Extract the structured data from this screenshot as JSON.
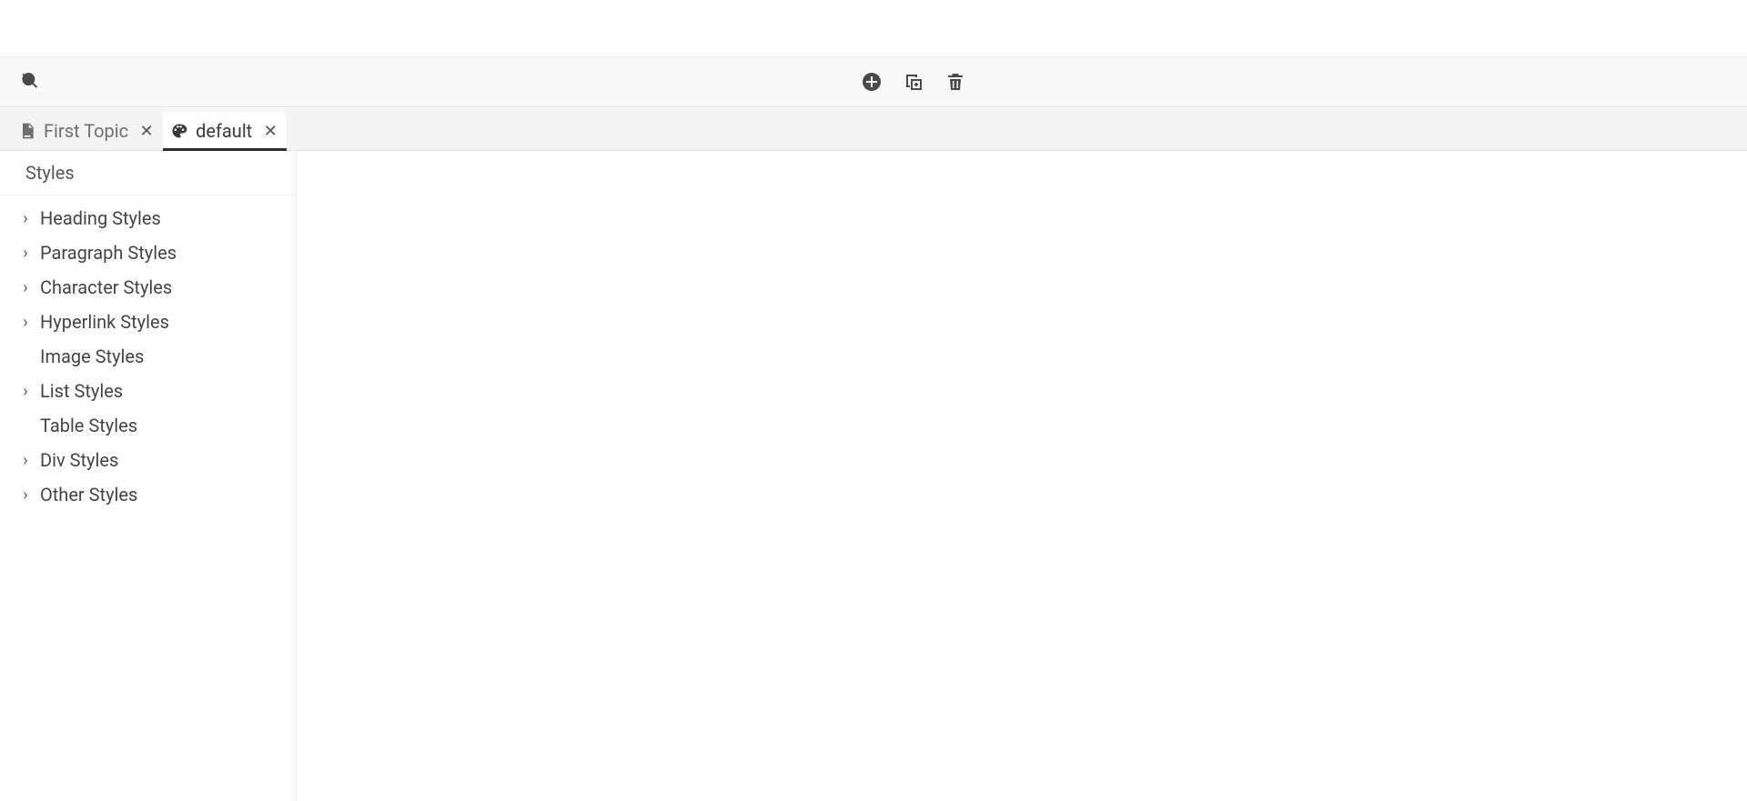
{
  "toolbar": {
    "search_icon": "search-refresh",
    "add_icon": "add",
    "duplicate_icon": "duplicate",
    "delete_icon": "delete"
  },
  "tabs": [
    {
      "label": "First Topic",
      "icon": "document",
      "active": false
    },
    {
      "label": "default",
      "icon": "palette",
      "active": true
    }
  ],
  "sidebar": {
    "header": "Styles",
    "items": [
      {
        "label": "Heading Styles",
        "expandable": true
      },
      {
        "label": "Paragraph Styles",
        "expandable": true
      },
      {
        "label": "Character Styles",
        "expandable": true
      },
      {
        "label": "Hyperlink Styles",
        "expandable": true
      },
      {
        "label": "Image Styles",
        "expandable": false
      },
      {
        "label": "List Styles",
        "expandable": true
      },
      {
        "label": "Table Styles",
        "expandable": false
      },
      {
        "label": "Div Styles",
        "expandable": true
      },
      {
        "label": "Other Styles",
        "expandable": true
      }
    ]
  }
}
